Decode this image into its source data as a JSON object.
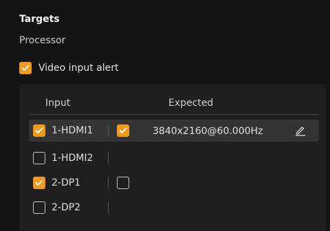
{
  "section": {
    "title": "Targets",
    "subtitle": "Processor"
  },
  "alert": {
    "label": "Video input alert",
    "checked": true
  },
  "table": {
    "columns": {
      "input": "Input",
      "expected": "Expected"
    },
    "rows": [
      {
        "input": "1-HDMI1",
        "input_checked": true,
        "expected_checked": true,
        "expected": "3840x2160@60.000Hz",
        "selected": true
      },
      {
        "input": "1-HDMI2",
        "input_checked": false
      },
      {
        "input": "2-DP1",
        "input_checked": true,
        "expected_checked": false
      },
      {
        "input": "2-DP2",
        "input_checked": false
      }
    ]
  },
  "colors": {
    "accent": "#f39a1e",
    "background": "#141414",
    "panel": "#1f1f1f",
    "selected_row": "#343434"
  },
  "icons": {
    "check": "check-icon",
    "edit": "edit-pencil-icon"
  }
}
